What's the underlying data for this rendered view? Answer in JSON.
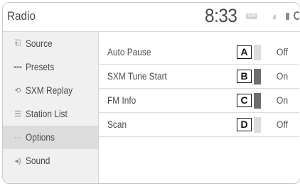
{
  "header": {
    "title": "Radio",
    "clock": "8:33",
    "status_badge_icon": "sirius-badge-icon",
    "signal_icon": "signal-bars-icon",
    "bluetooth_icon": "bluetooth-icon"
  },
  "sidebar": {
    "items": [
      {
        "label": "Source",
        "icon": "source-icon",
        "glyph": "⎗",
        "selected": false
      },
      {
        "label": "Presets",
        "icon": "presets-icon",
        "glyph": "▪▪▪",
        "selected": false
      },
      {
        "label": "SXM Replay",
        "icon": "replay-icon",
        "glyph": "⟲",
        "selected": false
      },
      {
        "label": "Station List",
        "icon": "station-list-icon",
        "glyph": "☰",
        "selected": false
      },
      {
        "label": "Options",
        "icon": "options-icon",
        "glyph": "···",
        "selected": true
      },
      {
        "label": "Sound",
        "icon": "sound-icon",
        "glyph": "◂)",
        "selected": false
      }
    ]
  },
  "options": {
    "rows": [
      {
        "label": "Auto Pause",
        "callout": "A",
        "value": "Off",
        "on": false
      },
      {
        "label": "SXM Tune Start",
        "callout": "B",
        "value": "On",
        "on": true
      },
      {
        "label": "FM Info",
        "callout": "C",
        "value": "On",
        "on": true
      },
      {
        "label": "Scan",
        "callout": "D",
        "value": "Off",
        "on": false
      }
    ]
  },
  "colors": {
    "indicator_on": "#6e6e6e",
    "indicator_off": "#dcdcdc",
    "selected_bg": "#dcdcdc",
    "sidebar_bg": "#f0f0f0"
  }
}
